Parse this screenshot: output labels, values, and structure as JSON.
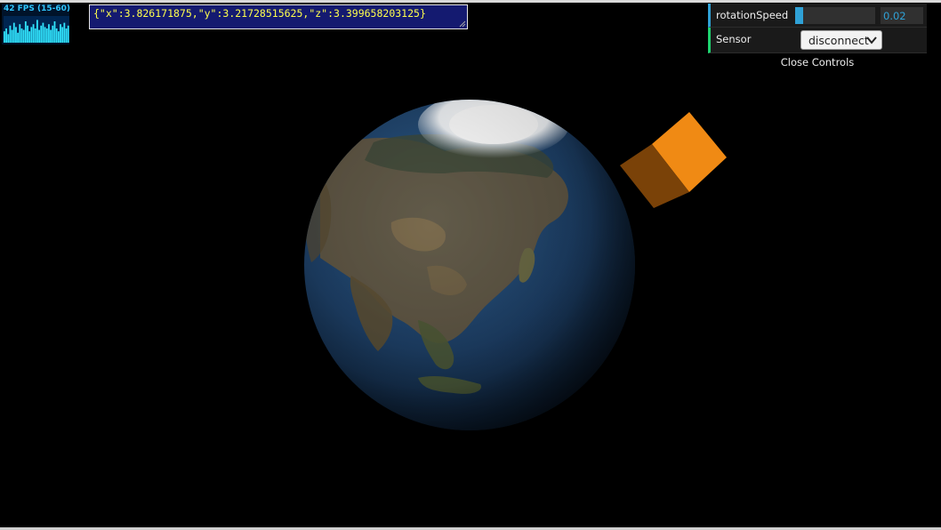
{
  "fps_meter": {
    "label": "42 FPS (15-60)",
    "history": [
      8,
      10,
      6,
      12,
      9,
      14,
      11,
      7,
      13,
      10,
      9,
      15,
      12,
      8,
      11,
      13,
      10,
      16,
      9,
      12,
      14,
      11,
      10,
      13,
      9,
      12,
      15,
      10,
      8,
      13,
      11,
      14,
      10,
      12
    ]
  },
  "coords": {
    "text": "{\"x\":3.826171875,\"y\":3.21728515625,\"z\":3.399658203125}"
  },
  "controls": {
    "rotation_speed": {
      "label": "rotationSpeed",
      "value": "0.02",
      "fraction": 0.1
    },
    "sensor": {
      "label": "Sensor",
      "selected": "disconnect"
    },
    "close_label": "Close Controls"
  },
  "colors": {
    "background": "#000000",
    "slider_accent": "#2fa1d6",
    "function_accent": "#1ed36f",
    "fps_text": "#31c8ff",
    "coords_text": "#ffff4d",
    "coords_bg": "#141a70",
    "cube_top": "#f08a14",
    "cube_side": "#7a4208"
  }
}
